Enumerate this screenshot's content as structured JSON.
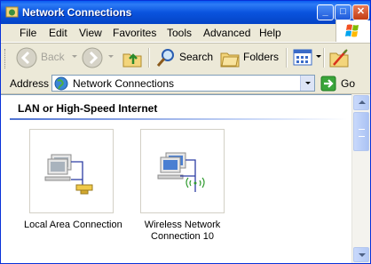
{
  "window": {
    "title": "Network Connections"
  },
  "title_buttons": {
    "minimize": "_",
    "maximize": "□",
    "close": "✕"
  },
  "menu": [
    "File",
    "Edit",
    "View",
    "Favorites",
    "Tools",
    "Advanced",
    "Help"
  ],
  "toolbar": {
    "back_label": "Back",
    "search_label": "Search",
    "folders_label": "Folders"
  },
  "address": {
    "label": "Address",
    "value": "Network Connections",
    "go_label": "Go"
  },
  "group": {
    "header": "LAN or High-Speed Internet"
  },
  "items": [
    {
      "caption_lines": [
        "Local Area Connection"
      ],
      "icon": "lan-connection-icon"
    },
    {
      "caption_lines": [
        "Wireless Network",
        "Connection 10"
      ],
      "icon": "wireless-connection-icon"
    }
  ],
  "colors": {
    "titlebar": "#0a54de",
    "window_bg": "#ece9d8",
    "group_line": "#4f73d1"
  }
}
